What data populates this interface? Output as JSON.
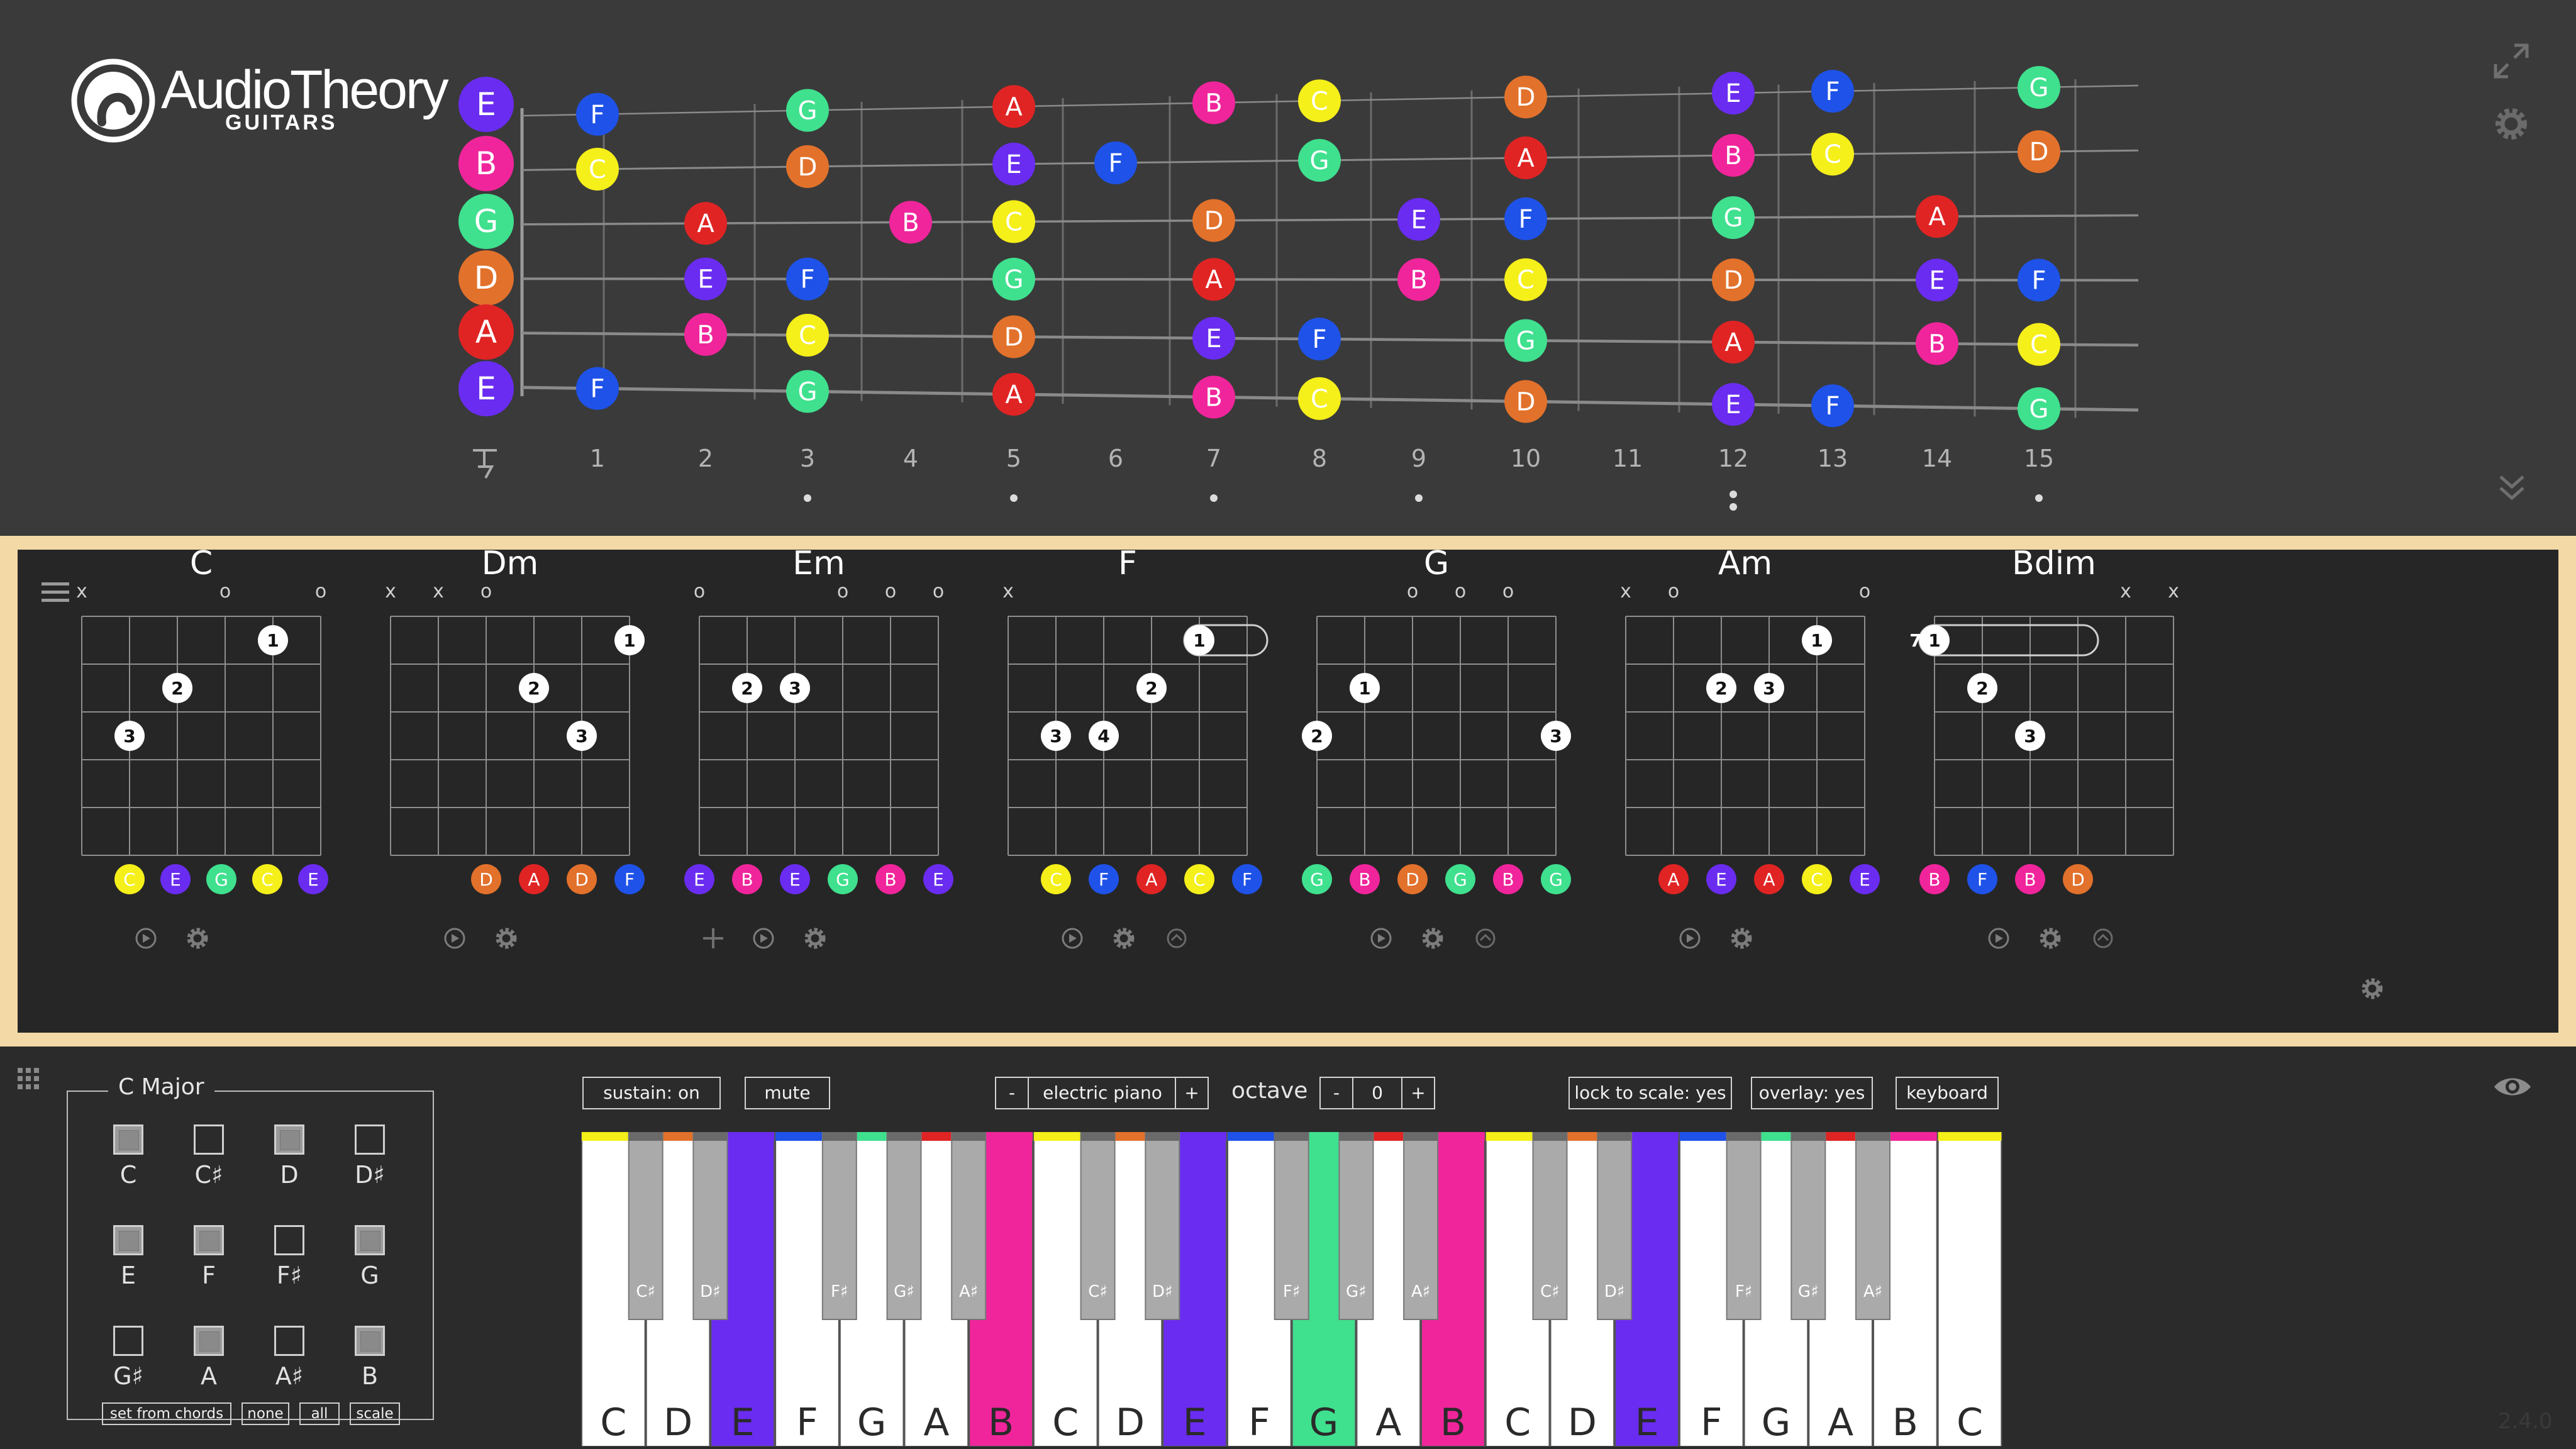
{
  "app": {
    "logo_name": "AudioTheory",
    "logo_sub": "GUITARS",
    "version": "2.4.0"
  },
  "icons": {
    "expand": "expand-arrows-icon",
    "settings": "gear-icon",
    "collapse": "double-chevron-down-icon",
    "menu": "hamburger-menu-icon",
    "grid": "grid-dots-icon",
    "eye": "eye-icon",
    "play": "play-icon",
    "move": "move-arrows-icon",
    "swap": "swap-icon",
    "capo": "capo-icon"
  },
  "note_colors": {
    "C": "#f5ef1a",
    "D": "#e2712b",
    "E": "#6a2cf0",
    "F": "#1f52e8",
    "G": "#3fe08e",
    "A": "#e02424",
    "B": "#f0259b"
  },
  "fretboard": {
    "open_strings": [
      "E",
      "B",
      "G",
      "D",
      "A",
      "E"
    ],
    "fret_numbers": [
      "1",
      "2",
      "3",
      "4",
      "5",
      "6",
      "7",
      "8",
      "9",
      "10",
      "11",
      "12",
      "13",
      "14",
      "15"
    ],
    "notes": [
      {
        "fret": 1,
        "string": 1,
        "n": "F"
      },
      {
        "fret": 1,
        "string": 2,
        "n": "C"
      },
      {
        "fret": 1,
        "string": 6,
        "n": "F"
      },
      {
        "fret": 2,
        "string": 3,
        "n": "A"
      },
      {
        "fret": 2,
        "string": 4,
        "n": "E"
      },
      {
        "fret": 2,
        "string": 5,
        "n": "B"
      },
      {
        "fret": 3,
        "string": 1,
        "n": "G"
      },
      {
        "fret": 3,
        "string": 2,
        "n": "D"
      },
      {
        "fret": 3,
        "string": 4,
        "n": "F"
      },
      {
        "fret": 3,
        "string": 5,
        "n": "C"
      },
      {
        "fret": 3,
        "string": 6,
        "n": "G"
      },
      {
        "fret": 4,
        "string": 3,
        "n": "B"
      },
      {
        "fret": 5,
        "string": 1,
        "n": "A"
      },
      {
        "fret": 5,
        "string": 2,
        "n": "E"
      },
      {
        "fret": 5,
        "string": 3,
        "n": "C"
      },
      {
        "fret": 5,
        "string": 4,
        "n": "G"
      },
      {
        "fret": 5,
        "string": 5,
        "n": "D"
      },
      {
        "fret": 5,
        "string": 6,
        "n": "A"
      },
      {
        "fret": 6,
        "string": 2,
        "n": "F"
      },
      {
        "fret": 7,
        "string": 1,
        "n": "B"
      },
      {
        "fret": 7,
        "string": 3,
        "n": "D"
      },
      {
        "fret": 7,
        "string": 4,
        "n": "A"
      },
      {
        "fret": 7,
        "string": 5,
        "n": "E"
      },
      {
        "fret": 7,
        "string": 6,
        "n": "B"
      },
      {
        "fret": 8,
        "string": 1,
        "n": "C"
      },
      {
        "fret": 8,
        "string": 2,
        "n": "G"
      },
      {
        "fret": 8,
        "string": 5,
        "n": "F"
      },
      {
        "fret": 8,
        "string": 6,
        "n": "C"
      },
      {
        "fret": 9,
        "string": 3,
        "n": "E"
      },
      {
        "fret": 9,
        "string": 4,
        "n": "B"
      },
      {
        "fret": 10,
        "string": 1,
        "n": "D"
      },
      {
        "fret": 10,
        "string": 2,
        "n": "A"
      },
      {
        "fret": 10,
        "string": 3,
        "n": "F"
      },
      {
        "fret": 10,
        "string": 4,
        "n": "C"
      },
      {
        "fret": 10,
        "string": 5,
        "n": "G"
      },
      {
        "fret": 10,
        "string": 6,
        "n": "D"
      },
      {
        "fret": 12,
        "string": 1,
        "n": "E"
      },
      {
        "fret": 12,
        "string": 2,
        "n": "B"
      },
      {
        "fret": 12,
        "string": 3,
        "n": "G"
      },
      {
        "fret": 12,
        "string": 4,
        "n": "D"
      },
      {
        "fret": 12,
        "string": 5,
        "n": "A"
      },
      {
        "fret": 12,
        "string": 6,
        "n": "E"
      },
      {
        "fret": 13,
        "string": 1,
        "n": "F"
      },
      {
        "fret": 13,
        "string": 2,
        "n": "C"
      },
      {
        "fret": 13,
        "string": 6,
        "n": "F"
      },
      {
        "fret": 14,
        "string": 3,
        "n": "A"
      },
      {
        "fret": 14,
        "string": 4,
        "n": "E"
      },
      {
        "fret": 14,
        "string": 5,
        "n": "B"
      },
      {
        "fret": 15,
        "string": 1,
        "n": "G"
      },
      {
        "fret": 15,
        "string": 2,
        "n": "D"
      },
      {
        "fret": 15,
        "string": 4,
        "n": "F"
      },
      {
        "fret": 15,
        "string": 5,
        "n": "C"
      },
      {
        "fret": 15,
        "string": 6,
        "n": "G"
      }
    ],
    "inlay_frets": [
      3,
      5,
      7,
      9,
      12,
      15
    ],
    "double_inlay_frets": [
      12
    ]
  },
  "chords": [
    {
      "name": "C",
      "markers": [
        "x",
        "",
        "",
        "o",
        "",
        "o"
      ],
      "dots": [
        {
          "s": 5,
          "f": 1,
          "l": "1"
        },
        {
          "s": 3,
          "f": 2,
          "l": "2"
        },
        {
          "s": 2,
          "f": 3,
          "l": "3"
        }
      ],
      "barre": null,
      "base": "",
      "notes": [
        "C",
        "E",
        "G",
        "C",
        "E"
      ],
      "notes_start": 1,
      "move": false
    },
    {
      "name": "Dm",
      "markers": [
        "x",
        "x",
        "o",
        "",
        "",
        ""
      ],
      "dots": [
        {
          "s": 6,
          "f": 1,
          "l": "1"
        },
        {
          "s": 4,
          "f": 2,
          "l": "2"
        },
        {
          "s": 5,
          "f": 3,
          "l": "3"
        }
      ],
      "barre": null,
      "base": "",
      "notes": [
        "D",
        "A",
        "D",
        "F"
      ],
      "notes_start": 3,
      "move": false
    },
    {
      "name": "Em",
      "markers": [
        "o",
        "",
        "",
        "o",
        "o",
        "o"
      ],
      "dots": [
        {
          "s": 2,
          "f": 2,
          "l": "2"
        },
        {
          "s": 3,
          "f": 2,
          "l": "3"
        }
      ],
      "barre": null,
      "base": "",
      "notes": [
        "E",
        "B",
        "E",
        "G",
        "B",
        "E"
      ],
      "notes_start": 1,
      "move": true
    },
    {
      "name": "F",
      "markers": [
        "x",
        "",
        "",
        "",
        "",
        ""
      ],
      "dots": [
        {
          "s": 5,
          "f": 1,
          "l": "1"
        },
        {
          "s": 4,
          "f": 2,
          "l": "2"
        },
        {
          "s": 2,
          "f": 3,
          "l": "3"
        },
        {
          "s": 3,
          "f": 3,
          "l": "4"
        }
      ],
      "barre": {
        "from": 5,
        "to": 6,
        "f": 1
      },
      "base": "",
      "notes": [
        "C",
        "F",
        "A",
        "C",
        "F"
      ],
      "notes_start": 2,
      "move": false
    },
    {
      "name": "G",
      "markers": [
        "",
        "",
        "o",
        "o",
        "o",
        ""
      ],
      "dots": [
        {
          "s": 2,
          "f": 2,
          "l": "1"
        },
        {
          "s": 1,
          "f": 3,
          "l": "2"
        },
        {
          "s": 6,
          "f": 3,
          "l": "3"
        }
      ],
      "barre": null,
      "base": "",
      "notes": [
        "G",
        "B",
        "D",
        "G",
        "B",
        "G"
      ],
      "notes_start": 1,
      "move": false
    },
    {
      "name": "Am",
      "markers": [
        "x",
        "o",
        "",
        "",
        "",
        "o"
      ],
      "dots": [
        {
          "s": 5,
          "f": 1,
          "l": "1"
        },
        {
          "s": 3,
          "f": 2,
          "l": "2"
        },
        {
          "s": 4,
          "f": 2,
          "l": "3"
        }
      ],
      "barre": null,
      "base": "",
      "notes": [
        "A",
        "E",
        "A",
        "C",
        "E"
      ],
      "notes_start": 2,
      "move": false
    },
    {
      "name": "Bdim",
      "markers": [
        "",
        "",
        "",
        "",
        "x",
        "x"
      ],
      "dots": [
        {
          "s": 1,
          "f": 1,
          "l": "1"
        },
        {
          "s": 2,
          "f": 2,
          "l": "2"
        },
        {
          "s": 3,
          "f": 3,
          "l": "3"
        }
      ],
      "barre": {
        "from": 1,
        "to": 4,
        "f": 1
      },
      "base": "7",
      "notes": [
        "B",
        "F",
        "B",
        "D"
      ],
      "notes_start": 1,
      "move": false
    }
  ],
  "scale": {
    "title": "C Major",
    "notes": [
      {
        "label": "C",
        "on": true
      },
      {
        "label": "C♯",
        "on": false
      },
      {
        "label": "D",
        "on": true
      },
      {
        "label": "D♯",
        "on": false
      },
      {
        "label": "E",
        "on": true
      },
      {
        "label": "F",
        "on": true
      },
      {
        "label": "F♯",
        "on": false
      },
      {
        "label": "G",
        "on": true
      },
      {
        "label": "G♯",
        "on": false
      },
      {
        "label": "A",
        "on": true
      },
      {
        "label": "A♯",
        "on": false
      },
      {
        "label": "B",
        "on": true
      }
    ],
    "buttons": [
      "set from chords",
      "none",
      "all",
      "scale"
    ]
  },
  "piano_controls": {
    "sustain": "sustain: on",
    "mute": "mute",
    "minus": "-",
    "instrument": "electric piano",
    "plus": "+",
    "octave_label": "octave",
    "octave_value": "0",
    "lock": "lock to scale: yes",
    "overlay": "overlay: yes",
    "keyboard": "keyboard"
  },
  "keyboard": {
    "white_keys": [
      "C",
      "D",
      "E",
      "F",
      "G",
      "A",
      "B",
      "C",
      "D",
      "E",
      "F",
      "G",
      "A",
      "B",
      "C",
      "D",
      "E",
      "F",
      "G",
      "A",
      "B",
      "C"
    ],
    "highlighted_whites": [
      2,
      6,
      9,
      11,
      13,
      16
    ],
    "black_keys": [
      {
        "after": 0,
        "label": "C♯"
      },
      {
        "after": 1,
        "label": "D♯"
      },
      {
        "after": 3,
        "label": "F♯"
      },
      {
        "after": 4,
        "label": "G♯"
      },
      {
        "after": 5,
        "label": "A♯"
      },
      {
        "after": 7,
        "label": "C♯"
      },
      {
        "after": 8,
        "label": "D♯"
      },
      {
        "after": 10,
        "label": "F♯"
      },
      {
        "after": 11,
        "label": "G♯"
      },
      {
        "after": 12,
        "label": "A♯"
      },
      {
        "after": 14,
        "label": "C♯"
      },
      {
        "after": 15,
        "label": "D♯"
      },
      {
        "after": 17,
        "label": "F♯"
      },
      {
        "after": 18,
        "label": "G♯"
      },
      {
        "after": 19,
        "label": "A♯"
      }
    ]
  }
}
